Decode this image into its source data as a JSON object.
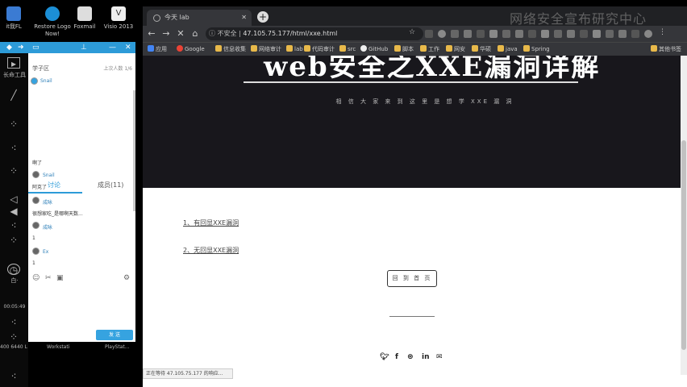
{
  "desktop": {
    "icons": [
      {
        "label": "it我FL"
      },
      {
        "label": "Restore Logo Now!"
      },
      {
        "label": "Foxmail"
      },
      {
        "label": "Visio 2013"
      }
    ],
    "bottom_labels": [
      "400 6440 L",
      "Workstati",
      "PlayStat..."
    ],
    "taskbar_label_top": "长命工具",
    "clock": "00:05:49",
    "taskbar_label_bottom": "白·"
  },
  "chat": {
    "title": "学子区",
    "subtitle": "上次人数 1/6",
    "user_name": "Snail",
    "tabs": [
      "讨论",
      "成员(11)"
    ],
    "messages": [
      {
        "name": "",
        "text": "啊了"
      },
      {
        "name": "Snail",
        "text": "阿克了"
      },
      {
        "name": "成咏",
        "text": "很想家吃_是哪啊天数..."
      },
      {
        "name": "成咏",
        "text": "1"
      },
      {
        "name": "Ex",
        "text": "1"
      }
    ],
    "send_label": "发 送"
  },
  "browser": {
    "tab_title": "今天 lab",
    "address_prefix": "不安全 |",
    "address_url": "47.105.75.177/html/xxe.html",
    "bookmarks": [
      "应用",
      "Google",
      "信息收集",
      "网络审计",
      "lab",
      "代码审计",
      "src",
      "GitHub",
      "脚本",
      "工作",
      "网安",
      "华硕",
      "java",
      "Spring",
      "其他书签"
    ],
    "watermark": "网络安全宣布研究中心"
  },
  "page": {
    "hero_title": "web安全之XXE漏洞详解",
    "hero_subtitle": "相 信 大 家 来 到 这 里 是 想 学 XXE 漏 洞",
    "links": [
      "1、有回显XXE漏洞",
      "2、无回显XXE漏洞"
    ],
    "home_button": "回 到 首 页",
    "social_icons": [
      "twitter-icon",
      "facebook-icon",
      "dribbble-icon",
      "linkedin-icon",
      "mail-icon"
    ],
    "status_text": "正在等待 47.105.75.177 的响应..."
  }
}
